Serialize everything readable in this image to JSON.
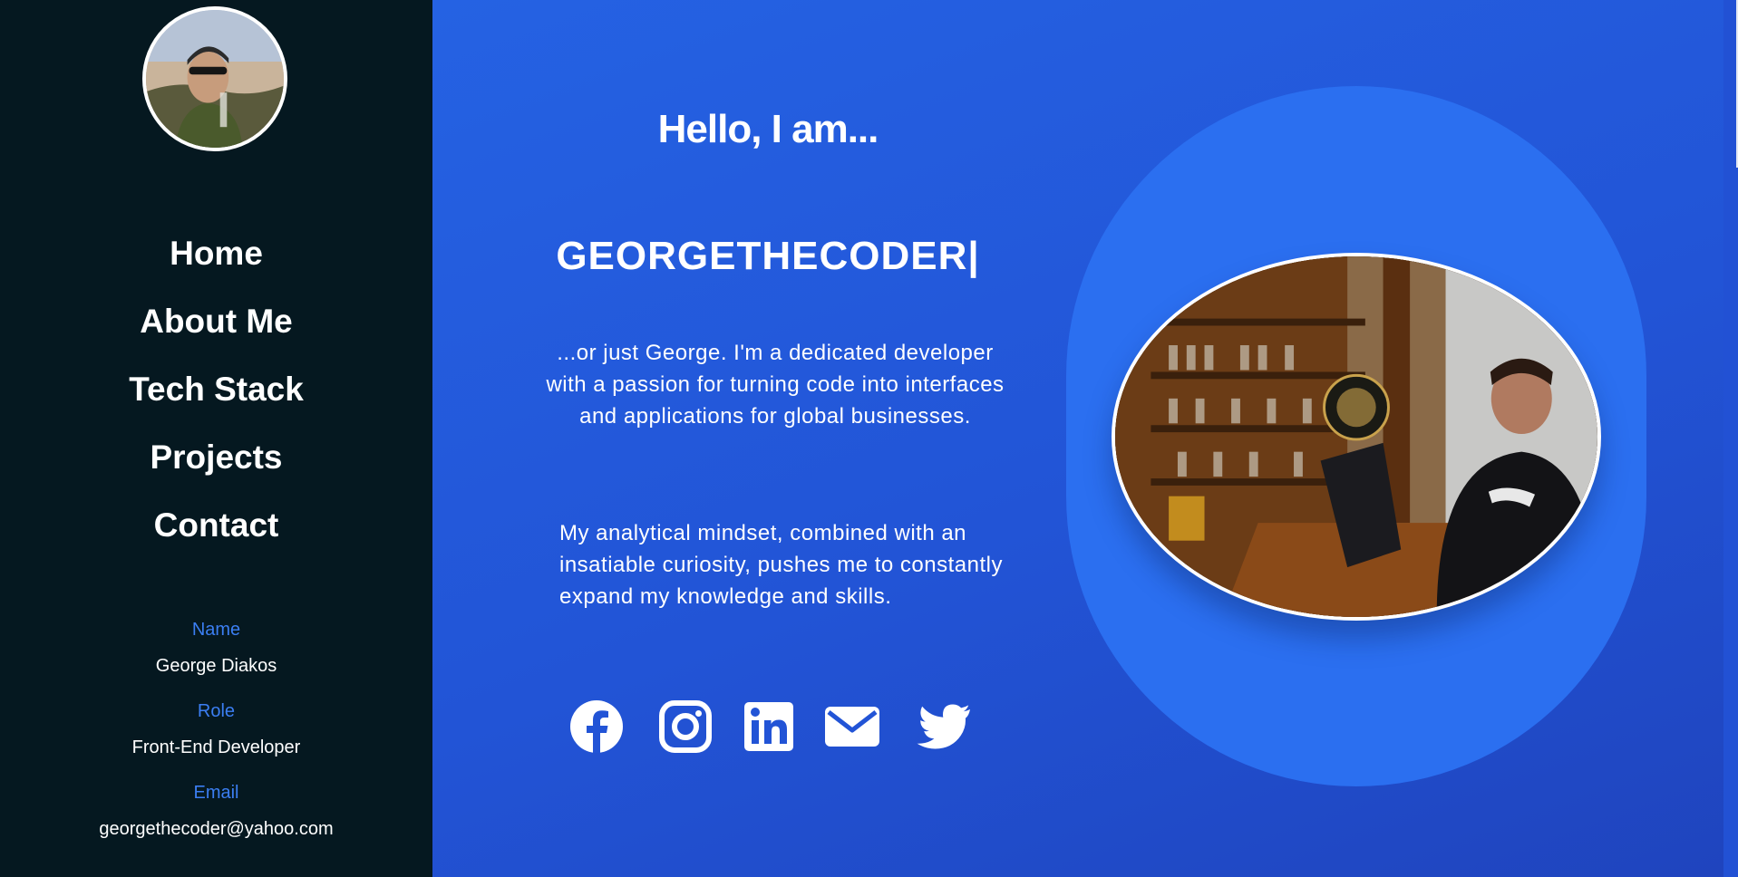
{
  "sidebar": {
    "avatar_alt": "George Diakos profile photo",
    "nav": [
      "Home",
      "About Me",
      "Tech Stack",
      "Projects",
      "Contact"
    ],
    "info": {
      "name_label": "Name",
      "name_value": "George Diakos",
      "role_label": "Role",
      "role_value": "Front-End Developer",
      "email_label": "Email",
      "email_value": "georgethecoder@yahoo.com"
    }
  },
  "hero": {
    "greeting": "Hello, I am...",
    "handle": "GEORGETHECODER|",
    "intro": "...or just George. I'm a dedicated developer with a passion for turning code into interfaces and applications for global businesses.",
    "detail": "My analytical mindset, combined with an insatiable curiosity, pushes me to constantly expand my knowledge and skills.",
    "photo_alt": "George working on a laptop",
    "socials": [
      "facebook-icon",
      "instagram-icon",
      "linkedin-icon",
      "email-icon",
      "twitter-icon"
    ]
  },
  "colors": {
    "sidebar_bg": "#051820",
    "main_bg": "#2254d6",
    "blob": "#2b6ff0",
    "accent_label": "#3b7ef2",
    "text": "#ffffff"
  }
}
